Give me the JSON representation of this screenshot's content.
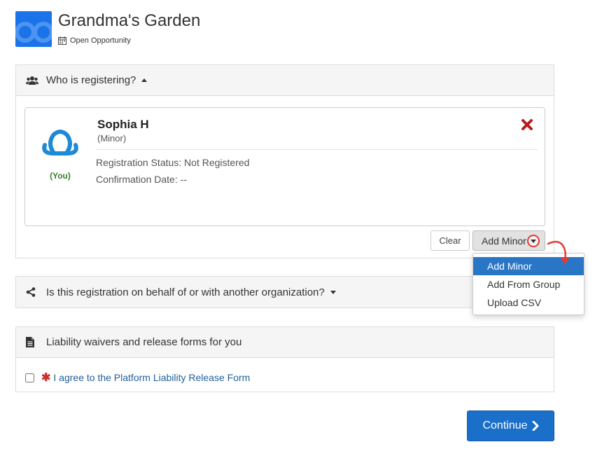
{
  "header": {
    "title": "Grandma's Garden",
    "subtitle": "Open Opportunity",
    "logo_color": "#1a73e8"
  },
  "registering": {
    "heading": "Who is registering?",
    "heading_icon": "users-icon",
    "person": {
      "name": "Sophia H",
      "type": "(Minor)",
      "you_label": "(You)",
      "status": "Registration Status: Not Registered",
      "confirmation": "Confirmation Date: --"
    },
    "clear_label": "Clear",
    "add_label": "Add Minor",
    "dropdown_items": [
      "Add Minor",
      "Add From Group",
      "Upload CSV"
    ]
  },
  "organization": {
    "heading": "Is this registration on behalf of or with another organization?",
    "heading_icon": "share-icon"
  },
  "waivers": {
    "heading": "Liability waivers and release forms for you",
    "heading_icon": "document-icon",
    "agree_label": "I agree to the Platform Liability Release Form"
  },
  "continue_label": "Continue",
  "colors": {
    "primary": "#1a6fc9",
    "remove": "#b71c1c",
    "you": "#3a7d29",
    "highlight": "#e53935"
  }
}
